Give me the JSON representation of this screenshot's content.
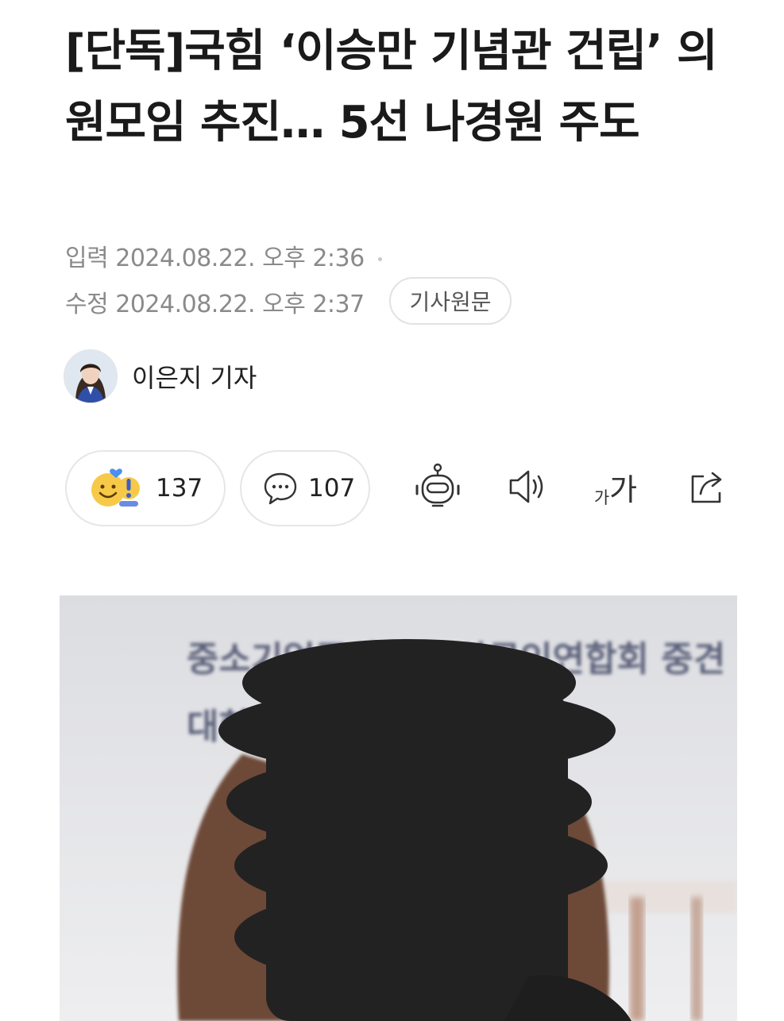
{
  "article": {
    "title": "[단독]국힘 ‘이승만 기념관 건립’ 의원모임 추진… 5선 나경원 주도",
    "input_label": "입력",
    "input_time": "2024.08.22. 오후 2:36",
    "modified_label": "수정",
    "modified_time": "2024.08.22. 오후 2:37",
    "original_link": "기사원문",
    "author": "이은지 기자"
  },
  "reactions": {
    "emotion_count": "137",
    "comment_count": "107"
  },
  "toolbar": {
    "font_size_small": "가",
    "font_size_large": "가"
  },
  "photo_backdrop": {
    "line1": "중소기업중앙회 소상공인연합회 중견",
    "line2": "대한 연합회 한국"
  },
  "icons": [
    "emotion-icon",
    "comment-icon",
    "ai-bot-icon",
    "speaker-icon",
    "font-size-icon",
    "share-icon"
  ],
  "colors": {
    "text": "#1a1a1a",
    "meta": "#8a8a8a",
    "border": "#e6e6e6",
    "emoji": "#f7c948"
  }
}
